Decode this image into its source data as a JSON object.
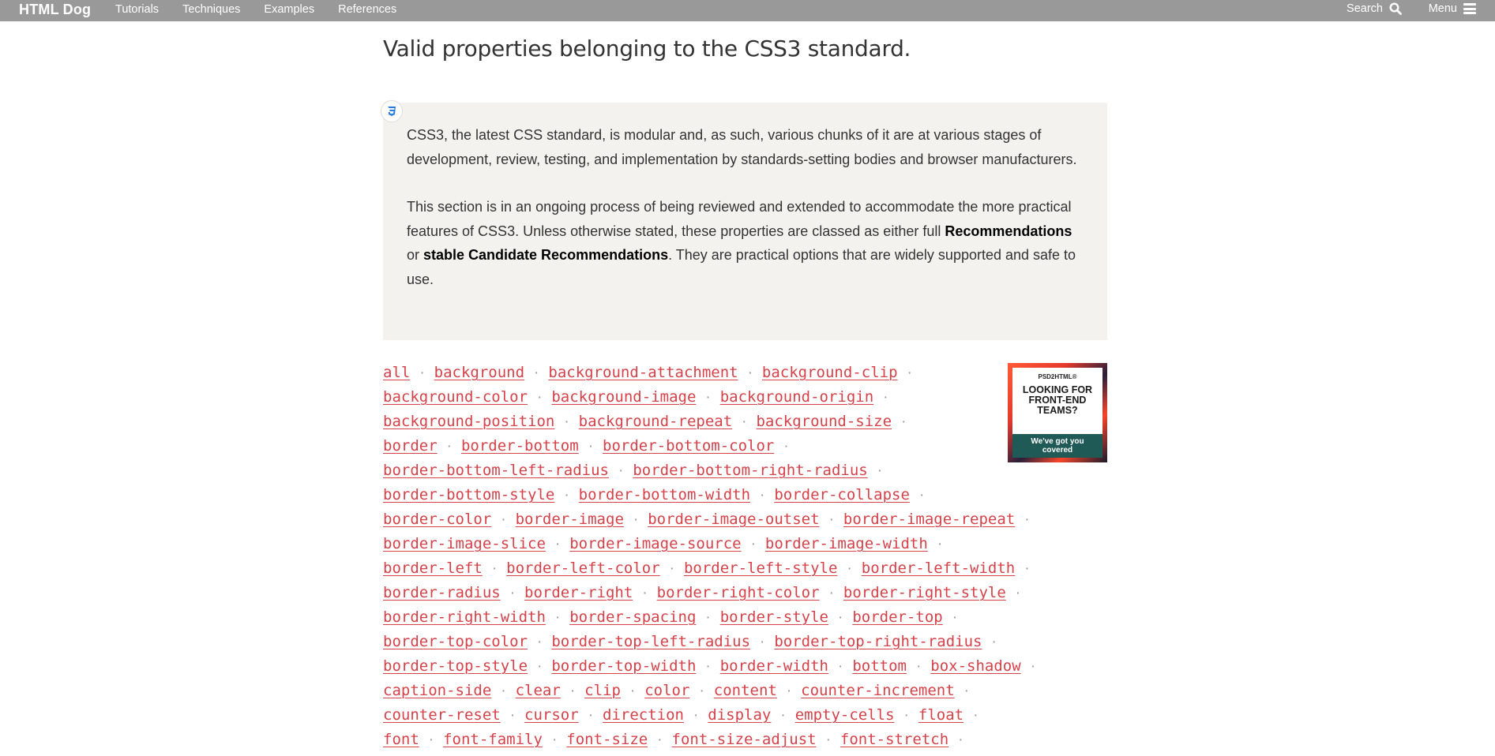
{
  "nav": {
    "brand": "HTML Dog",
    "links": [
      "Tutorials",
      "Techniques",
      "Examples",
      "References"
    ],
    "search_label": "Search",
    "menu_label": "Menu"
  },
  "page": {
    "intro": "Valid properties belonging to the CSS3 standard.",
    "note": {
      "para1": "CSS3, the latest CSS standard, is modular and, as such, various chunks of it are at various stages of development, review, testing, and implementation by standards-setting bodies and browser manufacturers.",
      "para2_start": "This section is in an ongoing process of being reviewed and extended to accommodate the more practical features of CSS3. Unless otherwise stated, these properties are classed as either full ",
      "bold1": "Recommendations",
      "mid": " or ",
      "bold2": "stable Candidate Recommendations",
      "para2_end": ". They are practical options that are widely supported and safe to use."
    },
    "separator": "·"
  },
  "properties": [
    "all",
    "background",
    "background-attachment",
    "background-clip",
    "background-color",
    "background-image",
    "background-origin",
    "background-position",
    "background-repeat",
    "background-size",
    "border",
    "border-bottom",
    "border-bottom-color",
    "border-bottom-left-radius",
    "border-bottom-right-radius",
    "border-bottom-style",
    "border-bottom-width",
    "border-collapse",
    "border-color",
    "border-image",
    "border-image-outset",
    "border-image-repeat",
    "border-image-slice",
    "border-image-source",
    "border-image-width",
    "border-left",
    "border-left-color",
    "border-left-style",
    "border-left-width",
    "border-radius",
    "border-right",
    "border-right-color",
    "border-right-style",
    "border-right-width",
    "border-spacing",
    "border-style",
    "border-top",
    "border-top-color",
    "border-top-left-radius",
    "border-top-right-radius",
    "border-top-style",
    "border-top-width",
    "border-width",
    "bottom",
    "box-shadow",
    "caption-side",
    "clear",
    "clip",
    "color",
    "content",
    "counter-increment",
    "counter-reset",
    "cursor",
    "direction",
    "display",
    "empty-cells",
    "float",
    "font",
    "font-family",
    "font-size",
    "font-size-adjust",
    "font-stretch"
  ],
  "ad": {
    "brand": "PSD2HTML®",
    "headline_lines": [
      "LOOKING FOR",
      "FRONT-END",
      "TEAMS?"
    ],
    "footer_lines": [
      "We've got you",
      "covered"
    ]
  },
  "colors": {
    "topbar": "#999999",
    "link": "#d6424a",
    "note_bg": "#f4f2ef"
  }
}
